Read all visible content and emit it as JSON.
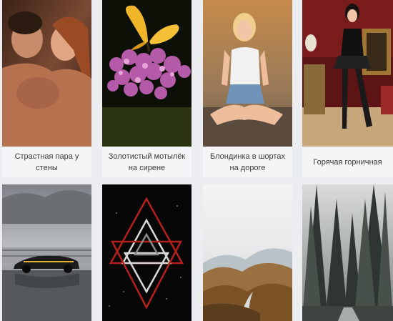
{
  "gallery": {
    "items": [
      {
        "caption": "Страстная пара у стены",
        "icon": "couple-photo"
      },
      {
        "caption": "Золотистый мотылёк на сирене",
        "icon": "butterfly-photo"
      },
      {
        "caption": "Блондинка в шортах на дороге",
        "icon": "woman-sitting-photo"
      },
      {
        "caption": "Горячая горничная",
        "icon": "maid-photo"
      },
      {
        "caption": "",
        "icon": "sports-car-photo"
      },
      {
        "caption": "",
        "icon": "geometric-triangles-photo"
      },
      {
        "caption": "",
        "icon": "autumn-mountains-photo"
      },
      {
        "caption": "",
        "icon": "pine-forest-photo"
      }
    ]
  },
  "colors": {
    "page_bg": "#ecedf1",
    "card_bg": "#f5f5f7",
    "caption_text": "#3a3a3a"
  }
}
